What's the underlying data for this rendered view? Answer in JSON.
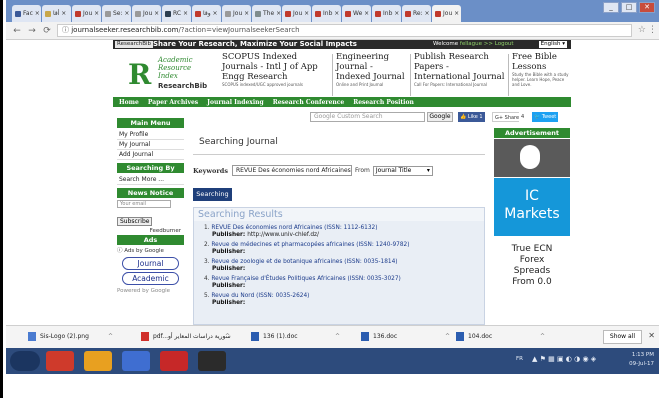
{
  "browser": {
    "tabs": [
      {
        "label": "Fac ×",
        "color": "#3b5998"
      },
      {
        "label": "أقا ×",
        "color": "#c8a74a"
      },
      {
        "label": "Jou ×",
        "color": "#c0392b"
      },
      {
        "label": "Se: ×",
        "color": "#999999"
      },
      {
        "label": "Jou ×",
        "color": "#999999"
      },
      {
        "label": "RC ×",
        "color": "#2c3e50"
      },
      {
        "label": "وقا ×",
        "color": "#c0392b"
      },
      {
        "label": "Jou ×",
        "color": "#999999"
      },
      {
        "label": "The ×",
        "color": "#7f8c8d"
      },
      {
        "label": "Jou ×",
        "color": "#c0392b"
      },
      {
        "label": "Inb ×",
        "color": "#c0392b"
      },
      {
        "label": "We ×",
        "color": "#c0392b"
      },
      {
        "label": "Inb ×",
        "color": "#c0392b"
      },
      {
        "label": "Re: ×",
        "color": "#c0392b"
      },
      {
        "label": "Jou ×",
        "color": "#c0392b"
      }
    ],
    "url_host": "journalseeker.researchbib.com",
    "url_path": "/?action=viewJournalseekerSearch",
    "url_prefix": "ⓘ "
  },
  "site": {
    "badge": "ResearchBib",
    "tagline": "Share Your Research, Maximize Your Social Impacts",
    "welcome": "Welcome",
    "user": "fellague",
    "logout": ">> Logout",
    "language": "English ▾",
    "logo": {
      "mark": "R",
      "line1": "Academic",
      "line2": "Resource",
      "line3": "Index",
      "line4": "ResearchBib"
    },
    "ads": [
      {
        "title": "SCOPUS Indexed Journals - Intl J of App Engg Research",
        "sub": "SCOPUS indexed/UGC approved journals"
      },
      {
        "title": "Engineering Journal - Indexed Journal",
        "sub": "Online and Print Journal"
      },
      {
        "title": "Publish Research Papers - International Journal",
        "sub": "Call For Papers: International Journal"
      },
      {
        "title": "Free Bible Lessons",
        "sub": "Study the Bible with a study helper. Learn Hope, Peace and Love."
      }
    ],
    "nav": [
      "Home",
      "Paper Archives",
      "Journal Indexing",
      "Research Conference",
      "Research Position"
    ],
    "cse_placeholder": "Google Custom Search",
    "google_btn": "Google",
    "like": "👍 Like 1",
    "gshare": "G+ Share",
    "gcount": "4",
    "tweet": "🐦 Tweet"
  },
  "left": {
    "main_menu": "Main Menu",
    "items": [
      "My Profile",
      "My Journal",
      "Add Journal"
    ],
    "searching_by": "Searching By",
    "search_more": "Search More ...",
    "news": "News Notice",
    "email_placeholder": "Your email",
    "subscribe": "Subscribe",
    "feedburner": "Feedburner",
    "ads": "Ads",
    "ads_by": "ⓘ Ads by Google",
    "pill1": "Journal",
    "pill2": "Academic",
    "powered": "Powered by Google"
  },
  "main": {
    "title": "Searching Journal",
    "keywords_label": "Keywords",
    "keyword_value": "REVUE Des économies nord Africaines",
    "from_label": "From",
    "from_value": "Journal Title",
    "search_btn": "Searching",
    "results_title": "Searching Results",
    "publisher_label": "Publisher:",
    "results": [
      {
        "n": "1.",
        "title": "REVUE Des économies nord Africaines (ISSN: 1112-6132)",
        "publisher": "http://www.univ-chlef.dz/"
      },
      {
        "n": "2.",
        "title": "Revue de médecines et pharmacopées africaines (ISSN: 1240-9782)",
        "publisher": ""
      },
      {
        "n": "3.",
        "title": "Revue de zoologie et de botanique africaines (ISSN: 0035-1814)",
        "publisher": ""
      },
      {
        "n": "4.",
        "title": "Revue Française d'Études Politiques Africaines (ISSN: 0035-3027)",
        "publisher": ""
      },
      {
        "n": "5.",
        "title": "Revue du Nord (ISSN: 0035-2624)",
        "publisher": ""
      }
    ]
  },
  "right": {
    "advert": "Advertisement",
    "ic1": "IC",
    "ic2": "Markets",
    "forex1": "True ECN",
    "forex2": "Forex",
    "forex3": "Spreads",
    "forex4": "From 0.0"
  },
  "downloads": [
    {
      "name": "Sis-Logo (2).png",
      "color": "#4a7bd0"
    },
    {
      "name": "pdf...سورية دراسات المعاير أو",
      "color": "#d0302b"
    },
    {
      "name": "136 (1).doc",
      "color": "#2b5db0"
    },
    {
      "name": "136.doc",
      "color": "#2b5db0"
    },
    {
      "name": "104.doc",
      "color": "#2b5db0"
    }
  ],
  "downloads_showall": "Show all",
  "taskbar": {
    "apps": [
      "#cf3a2b",
      "#e8a020",
      "#3f6ed1",
      "#c62828",
      "#2b2b2b"
    ],
    "lang": "FR",
    "time": "1:13 PM",
    "date": "09-Jul-17"
  }
}
